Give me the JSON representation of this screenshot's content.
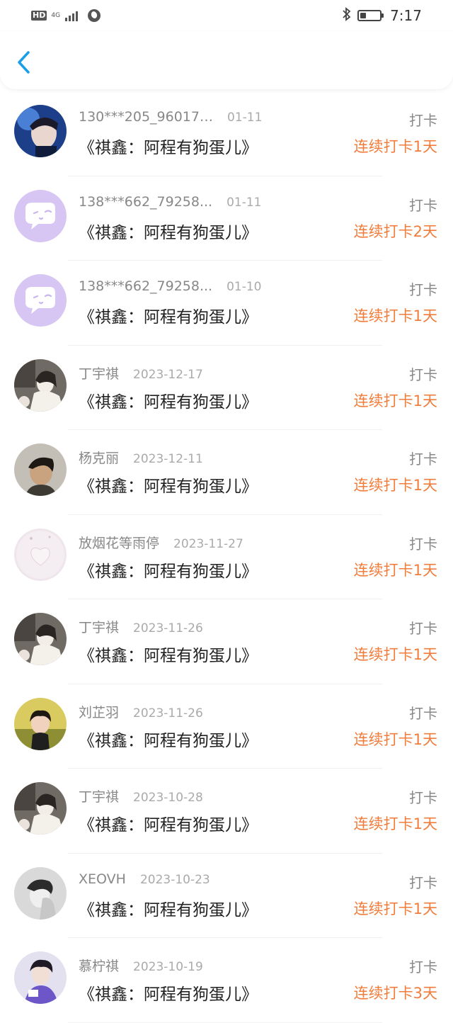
{
  "status_bar": {
    "network_badge": "HD",
    "network_type": "4G",
    "time": "7:17"
  },
  "header": {
    "back_icon": "chevron-left-icon",
    "accent_color": "#1a9ee6"
  },
  "colors": {
    "streak": "#f07d3c",
    "meta": "#888888",
    "title": "#222222"
  },
  "entries": [
    {
      "name": "130***205_960174...",
      "date": "01-11",
      "title": "《祺鑫：阿程有狗蛋儿》",
      "action": "打卡",
      "streak": "连续打卡1天",
      "avatar": "avatar-person-blue"
    },
    {
      "name": "138***662_79258...",
      "date": "01-11",
      "title": "《祺鑫：阿程有狗蛋儿》",
      "action": "打卡",
      "streak": "连续打卡2天",
      "avatar": "avatar-default-purple"
    },
    {
      "name": "138***662_79258...",
      "date": "01-10",
      "title": "《祺鑫：阿程有狗蛋儿》",
      "action": "打卡",
      "streak": "连续打卡1天",
      "avatar": "avatar-default-purple"
    },
    {
      "name": "丁宇祺",
      "date": "2023-12-17",
      "title": "《祺鑫：阿程有狗蛋儿》",
      "action": "打卡",
      "streak": "连续打卡1天",
      "avatar": "avatar-photo-girl"
    },
    {
      "name": "杨克丽",
      "date": "2023-12-11",
      "title": "《祺鑫：阿程有狗蛋儿》",
      "action": "打卡",
      "streak": "连续打卡1天",
      "avatar": "avatar-photo-woman"
    },
    {
      "name": "放烟花等雨停",
      "date": "2023-11-27",
      "title": "《祺鑫：阿程有狗蛋儿》",
      "action": "打卡",
      "streak": "连续打卡1天",
      "avatar": "avatar-photo-heart"
    },
    {
      "name": "丁宇祺",
      "date": "2023-11-26",
      "title": "《祺鑫：阿程有狗蛋儿》",
      "action": "打卡",
      "streak": "连续打卡1天",
      "avatar": "avatar-photo-girl"
    },
    {
      "name": "刘芷羽",
      "date": "2023-11-26",
      "title": "《祺鑫：阿程有狗蛋儿》",
      "action": "打卡",
      "streak": "连续打卡1天",
      "avatar": "avatar-photo-child"
    },
    {
      "name": "丁宇祺",
      "date": "2023-10-28",
      "title": "《祺鑫：阿程有狗蛋儿》",
      "action": "打卡",
      "streak": "连续打卡1天",
      "avatar": "avatar-photo-girl"
    },
    {
      "name": "XEOVH",
      "date": "2023-10-23",
      "title": "《祺鑫：阿程有狗蛋儿》",
      "action": "打卡",
      "streak": "连续打卡1天",
      "avatar": "avatar-photo-gray"
    },
    {
      "name": "慕柠祺",
      "date": "2023-10-19",
      "title": "《祺鑫：阿程有狗蛋儿》",
      "action": "打卡",
      "streak": "连续打卡3天",
      "avatar": "avatar-photo-purple"
    }
  ]
}
